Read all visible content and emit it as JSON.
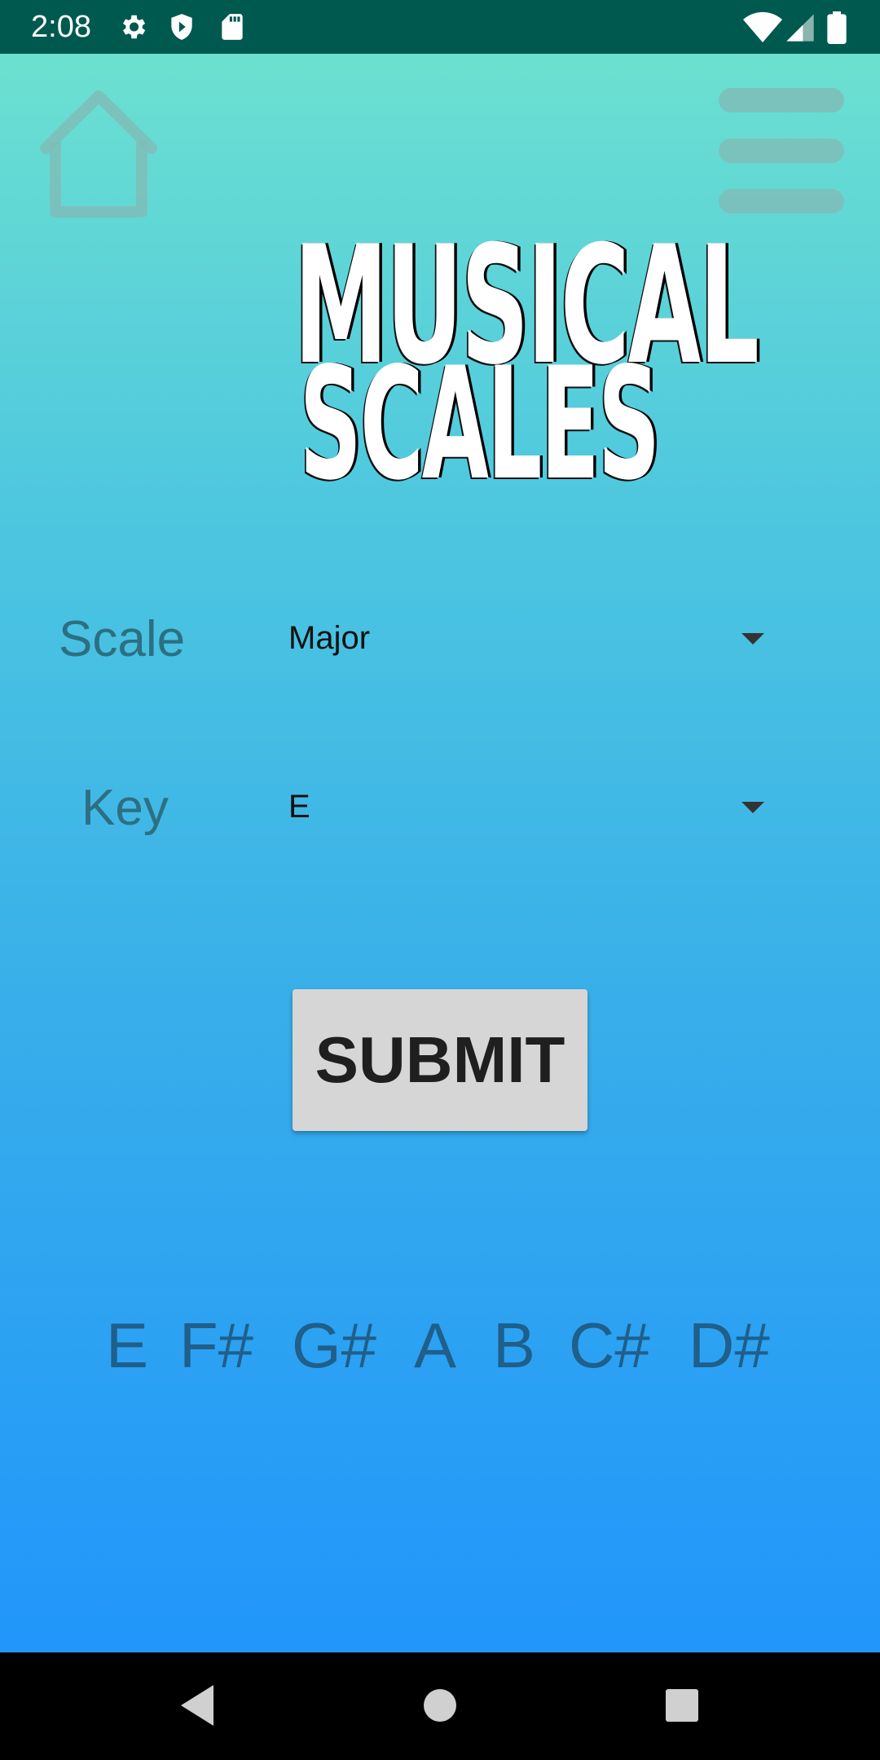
{
  "status_bar": {
    "time": "2:08",
    "icons": [
      "settings-icon",
      "shield-icon",
      "sd-card-icon",
      "wifi-icon",
      "signal-icon",
      "battery-icon"
    ]
  },
  "header": {
    "home_icon": "home-icon",
    "menu_icon": "hamburger-menu-icon"
  },
  "logo": {
    "line1": "MUSICAL",
    "line2": "SCALES"
  },
  "form": {
    "scale_label": "Scale",
    "scale_value": "Major",
    "key_label": "Key",
    "key_value": "E",
    "submit_label": "SUBMIT"
  },
  "result": {
    "notes": [
      "E",
      "F#",
      "G#",
      "A",
      "B",
      "C#",
      "D#"
    ]
  },
  "nav_bar": {
    "icons": [
      "back-icon",
      "home-circle-icon",
      "recents-icon"
    ]
  },
  "colors": {
    "status_bar": "#00594f",
    "gradient_top": "#6ce0d0",
    "gradient_bottom": "#2196fb",
    "label_text": "#2d6f82",
    "notes_text": "#1f5f8a",
    "button_bg": "#d6d6d6"
  }
}
